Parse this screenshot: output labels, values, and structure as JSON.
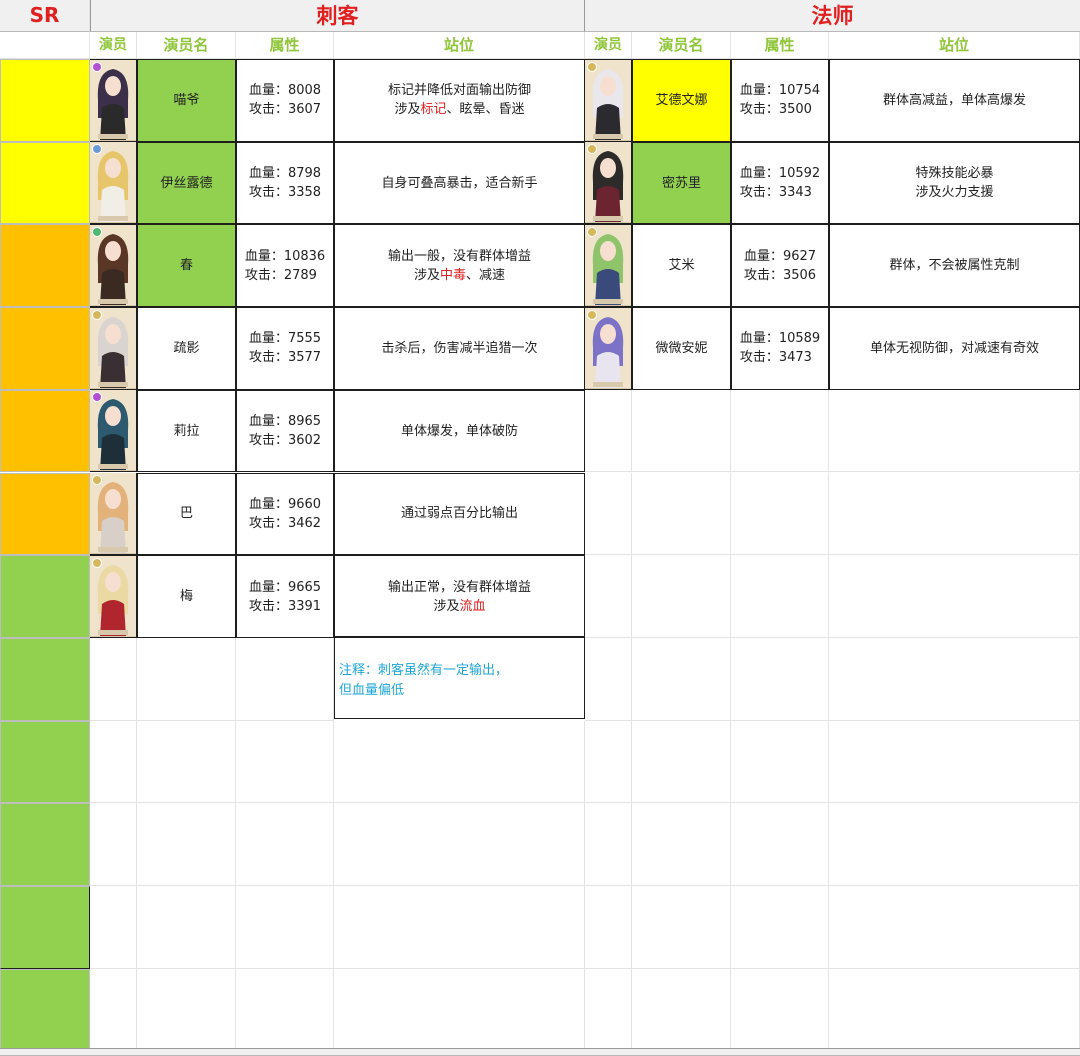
{
  "rank_label": "SR",
  "sections": {
    "assassin": {
      "title": "刺客",
      "headers": [
        "演员",
        "演员名",
        "属性",
        "站位"
      ],
      "rows": [
        {
          "name": "喵爷",
          "attr": "血量：8008\n攻击：3607",
          "pos": [
            "标记并降低对面输出防御\n涉及",
            "标记",
            "、眩晕、昏迷"
          ],
          "tier": "#ffff00",
          "name_bg": "#92d050"
        },
        {
          "name": "伊丝露德",
          "attr": "血量：8798\n攻击：3358",
          "pos": [
            "自身可叠高暴击，适合新手",
            "",
            ""
          ],
          "tier": "#ffff00",
          "name_bg": "#92d050"
        },
        {
          "name": "春",
          "attr": "血量：10836\n攻击：2789",
          "pos": [
            "输出一般，没有群体增益\n涉及",
            "中毒",
            "、减速"
          ],
          "tier": "#ffc000",
          "name_bg": "#92d050"
        },
        {
          "name": "疏影",
          "attr": "血量：7555\n攻击：3577",
          "pos": [
            "击杀后，伤害减半追猎一次",
            "",
            ""
          ],
          "tier": "#ffc000",
          "name_bg": "#ffffff"
        },
        {
          "name": "莉拉",
          "attr": "血量：8965\n攻击：3602",
          "pos": [
            "单体爆发，单体破防",
            "",
            ""
          ],
          "tier": "#ffc000",
          "name_bg": "#ffffff"
        },
        {
          "name": "巴",
          "attr": "血量：9660\n攻击：3462",
          "pos": [
            "通过弱点百分比输出",
            "",
            ""
          ],
          "tier": "#ffc000",
          "name_bg": "#ffffff"
        },
        {
          "name": "梅",
          "attr": "血量：9665\n攻击：3391",
          "pos": [
            "输出正常，没有群体增益\n涉及",
            "流血",
            ""
          ],
          "tier": "#92d050",
          "name_bg": "#ffffff"
        }
      ],
      "note": "注释：刺客虽然有一定输出，\n        但血量偏低"
    },
    "mage": {
      "title": "法师",
      "headers": [
        "演员",
        "演员名",
        "属性",
        "站位"
      ],
      "rows": [
        {
          "name": "艾德文娜",
          "attr": "血量：10754\n攻击：3500",
          "pos": "群体高减益，单体高爆发",
          "name_bg": "#ffff00"
        },
        {
          "name": "密苏里",
          "attr": "血量：10592\n攻击：3343",
          "pos": "特殊技能必暴\n涉及火力支援",
          "name_bg": "#92d050"
        },
        {
          "name": "艾米",
          "attr": "血量：9627\n攻击：3506",
          "pos": "群体，不会被属性克制",
          "name_bg": "#ffffff"
        },
        {
          "name": "微微安妮",
          "attr": "血量：10589\n攻击：3473",
          "pos": "单体无视防御，对减速有奇效",
          "name_bg": "#ffffff"
        }
      ]
    }
  },
  "portraits": {
    "assassin": [
      {
        "hair": "#3b2f4a",
        "outfit": "#2a2a2a",
        "pip": "#b44fd1",
        "icon": "portrait-image"
      },
      {
        "hair": "#e7c66b",
        "outfit": "#f1eee7",
        "pip": "#6c9ad6",
        "icon": "portrait-image"
      },
      {
        "hair": "#5a3626",
        "outfit": "#3b2a22",
        "pip": "#4cb96e",
        "icon": "portrait-image"
      },
      {
        "hair": "#d9d4d0",
        "outfit": "#3a2f33",
        "pip": "#d6b85a",
        "icon": "portrait-image"
      },
      {
        "hair": "#2d5a6e",
        "outfit": "#1f2f3a",
        "pip": "#b44fd1",
        "icon": "portrait-image"
      },
      {
        "hair": "#e2b27a",
        "outfit": "#d8d0c8",
        "pip": "#d6b85a",
        "icon": "portrait-image"
      },
      {
        "hair": "#ead9a3",
        "outfit": "#b0262e",
        "pip": "#d6b85a",
        "icon": "portrait-image"
      }
    ],
    "mage": [
      {
        "hair": "#e9e7ec",
        "outfit": "#2b2a2e",
        "pip": "#d6b85a",
        "icon": "portrait-image"
      },
      {
        "hair": "#2d2a2a",
        "outfit": "#6b2430",
        "pip": "#d6b85a",
        "icon": "portrait-image"
      },
      {
        "hair": "#8fc46a",
        "outfit": "#3a4a7a",
        "pip": "#d6b85a",
        "icon": "portrait-image"
      },
      {
        "hair": "#7c73c9",
        "outfit": "#e8e4f0",
        "pip": "#d6b85a",
        "icon": "portrait-image"
      }
    ]
  },
  "tier_colors_extra": [
    "#92d050",
    "#92d050",
    "#92d050",
    "#92d050",
    "#92d050"
  ]
}
